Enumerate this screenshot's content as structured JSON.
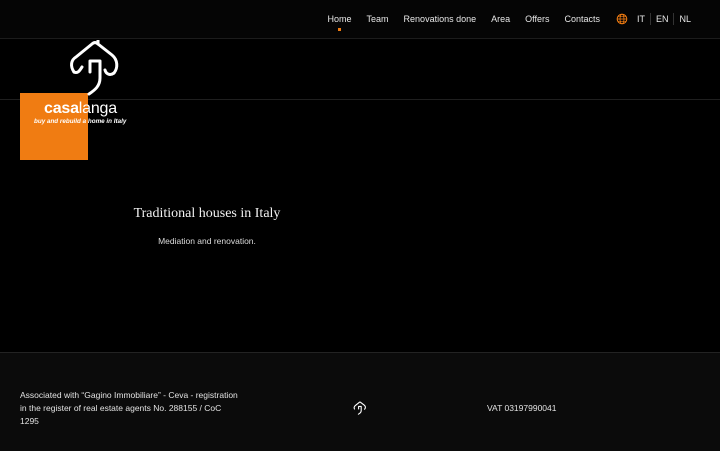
{
  "nav": {
    "items": [
      {
        "label": "Home",
        "active": true
      },
      {
        "label": "Team",
        "active": false
      },
      {
        "label": "Renovations done",
        "active": false
      },
      {
        "label": "Area",
        "active": false
      },
      {
        "label": "Offers",
        "active": false
      },
      {
        "label": "Contacts",
        "active": false
      }
    ]
  },
  "languages": {
    "icon": "globe-icon",
    "items": [
      "IT",
      "EN",
      "NL"
    ]
  },
  "logo": {
    "brand_bold": "casa",
    "brand_light": "langa",
    "tagline": "buy and rebuild a home in Italy",
    "icon": "house-icon"
  },
  "hero": {
    "title": "Traditional houses in Italy",
    "subtitle": "Mediation and renovation."
  },
  "footer": {
    "association": "Associated with “Gagino Immobiliare” - Ceva - registration in the register of real estate agents No. 288155 / CoC 1295",
    "icon": "house-icon",
    "vat": "VAT 03197990041"
  },
  "colors": {
    "accent": "#f07c12",
    "background": "#000000",
    "footer_background": "#0b0b0b",
    "text": "#ffffff"
  }
}
